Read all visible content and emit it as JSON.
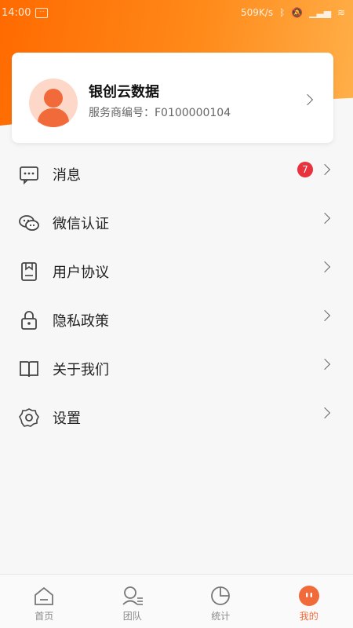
{
  "status_bar": {
    "time": "14:00",
    "net_speed": "509K/s"
  },
  "profile": {
    "company_name": "银创云数据",
    "merchant_label": "服务商编号：",
    "merchant_no": "F0100000104"
  },
  "menu": [
    {
      "label": "消息",
      "icon": "message-icon",
      "badge": "7"
    },
    {
      "label": "微信认证",
      "icon": "wechat-icon"
    },
    {
      "label": "用户协议",
      "icon": "agreement-icon"
    },
    {
      "label": "隐私政策",
      "icon": "lock-icon"
    },
    {
      "label": "关于我们",
      "icon": "book-icon"
    },
    {
      "label": "设置",
      "icon": "gear-icon"
    }
  ],
  "tabs": [
    {
      "label": "首页",
      "icon": "home-icon"
    },
    {
      "label": "团队",
      "icon": "team-icon"
    },
    {
      "label": "统计",
      "icon": "pie-chart-icon"
    },
    {
      "label": "我的",
      "icon": "profile-icon",
      "active": true
    }
  ],
  "colors": {
    "accent": "#f06a3a",
    "badge": "#e8323c",
    "header_start": "#ff6a00",
    "header_end": "#ffb04a"
  }
}
